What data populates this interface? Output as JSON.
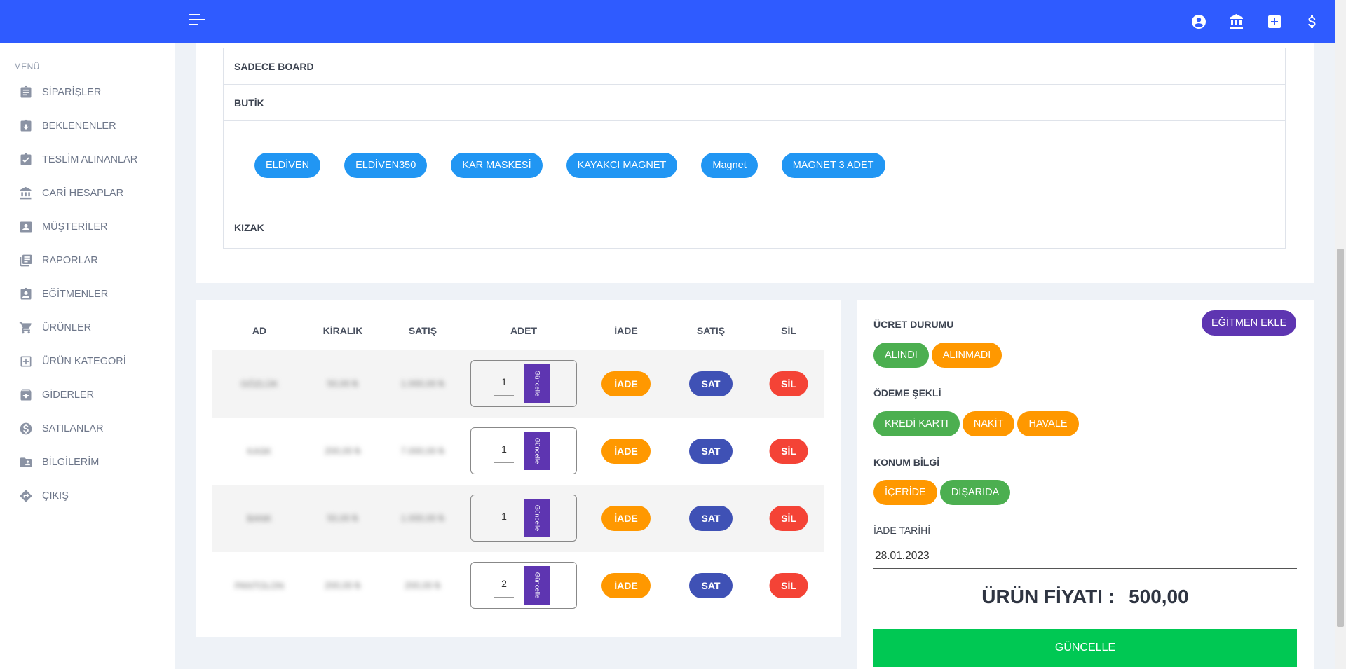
{
  "sidebar": {
    "heading": "MENÜ",
    "items": [
      {
        "label": "SİPARİŞLER",
        "icon": "clipboard-icon"
      },
      {
        "label": "BEKLENENLER",
        "icon": "pending-icon"
      },
      {
        "label": "TESLİM ALINANLAR",
        "icon": "check-clipboard-icon"
      },
      {
        "label": "CARİ HESAPLAR",
        "icon": "bank-icon"
      },
      {
        "label": "MÜŞTERİLER",
        "icon": "contact-card-icon"
      },
      {
        "label": "RAPORLAR",
        "icon": "report-icon"
      },
      {
        "label": "EĞİTMENLER",
        "icon": "instructor-icon"
      },
      {
        "label": "ÜRÜNLER",
        "icon": "cart-icon"
      },
      {
        "label": "ÜRÜN KATEGORİ",
        "icon": "add-box-icon"
      },
      {
        "label": "GİDERLER",
        "icon": "archive-icon"
      },
      {
        "label": "SATILANLAR",
        "icon": "dollar-circle-icon"
      },
      {
        "label": "BİLGİLERİM",
        "icon": "folder-user-icon"
      },
      {
        "label": "ÇIKIŞ",
        "icon": "logout-icon"
      }
    ]
  },
  "topbar": {
    "icons": [
      "account-icon",
      "bank-icon",
      "plus-box-icon",
      "dollar-icon"
    ],
    "color": "#2f5bff"
  },
  "categories": {
    "rows_top": [
      "SADECE BOARD",
      "BUTİK"
    ],
    "chips": [
      "ELDİVEN",
      "ELDİVEN350",
      "KAR MASKESİ",
      "KAYAKCI MAGNET",
      "Magnet",
      "MAGNET 3 ADET"
    ],
    "rows_bottom": [
      "KIZAK"
    ]
  },
  "table": {
    "headers": [
      "AD",
      "KİRALIK",
      "SATIŞ",
      "ADET",
      "İADE",
      "SATIŞ",
      "SİL"
    ],
    "update_label": "Güncelle",
    "iade_label": "İADE",
    "sat_label": "SAT",
    "sil_label": "SİL",
    "rows": [
      {
        "name": "GÖZLÜK",
        "rent": "50,00 ₺",
        "sale": "1.000,00 ₺",
        "qty": "1"
      },
      {
        "name": "KASK",
        "rent": "200,00 ₺",
        "sale": "7.000,00 ₺",
        "qty": "1"
      },
      {
        "name": "BANK",
        "rent": "50,00 ₺",
        "sale": "1.000,00 ₺",
        "qty": "1"
      },
      {
        "name": "PANTOLON",
        "rent": "200,00 ₺",
        "sale": "200,00 ₺",
        "qty": "2"
      }
    ]
  },
  "panel": {
    "add_instructor": "EĞİTMEN EKLE",
    "fee_status_label": "ÜCRET DURUMU",
    "fee_options": [
      "ALINDI",
      "ALINMADI"
    ],
    "payment_label": "ÖDEME ŞEKLİ",
    "payment_options": [
      "KREDİ KARTI",
      "NAKİT",
      "HAVALE"
    ],
    "location_label": "KONUM BİLGİ",
    "location_options": [
      "İÇERİDE",
      "DIŞARIDA"
    ],
    "return_date_label": "İADE TARİHİ",
    "return_date": "28.01.2023",
    "price_label": "ÜRÜN FİYATI :",
    "price_value": "500,00",
    "update_button": "GÜNCELLE"
  }
}
